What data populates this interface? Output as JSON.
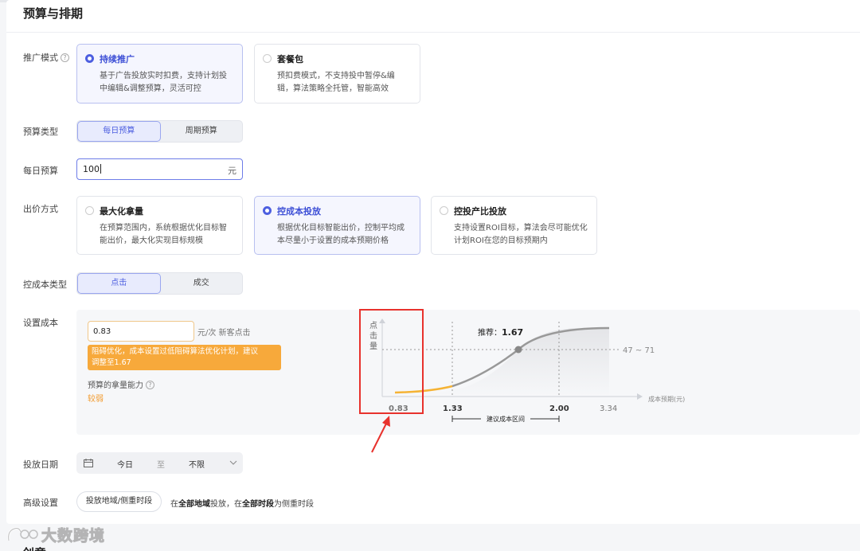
{
  "section": {
    "title": "预算与排期"
  },
  "bottom_title": "创意",
  "promo_mode": {
    "label": "推广模式",
    "options": [
      {
        "title": "持续推广",
        "desc1": "基于广告投放实时扣费，支持计划投",
        "desc2": "中编辑&调整预算，灵活可控",
        "selected": true
      },
      {
        "title": "套餐包",
        "desc1": "预扣费模式，不支持投中暂停&编",
        "desc2": "辑，算法策略全托管，智能高效",
        "selected": false
      }
    ]
  },
  "budget_type": {
    "label": "预算类型",
    "options": [
      "每日预算",
      "周期预算"
    ],
    "selected": "每日预算"
  },
  "daily_budget": {
    "label": "每日预算",
    "value": "100",
    "unit": "元"
  },
  "bid_method": {
    "label": "出价方式",
    "options": [
      {
        "title": "最大化拿量",
        "desc1": "在预算范围内，系统根据优化目标智",
        "desc2": "能出价，最大化实现目标规模",
        "selected": false
      },
      {
        "title": "控成本投放",
        "desc1": "根据优化目标智能出价，控制平均成",
        "desc2": "本尽量小于设置的成本预期价格",
        "selected": true
      },
      {
        "title": "控投产比投放",
        "desc1": "支持设置ROI目标，算法会尽可能优化",
        "desc2": "计划ROI在您的目标预期内",
        "selected": false
      }
    ]
  },
  "cost_type": {
    "label": "控成本类型",
    "options": [
      "点击",
      "成交"
    ],
    "selected": "点击"
  },
  "set_cost": {
    "label": "设置成本",
    "value": "0.83",
    "unit": "元/次 新客点击",
    "warning_line1": "阻碍优化，成本设置过低阻碍算法优化计划，建议",
    "warning_line2": "调整至1.67",
    "capability_label": "预算的拿量能力",
    "capability_value": "较弱"
  },
  "chart_data": {
    "type": "line",
    "ylabel": "点击量",
    "xlabel": "成本预期(元)",
    "x_ticks": [
      "0.83",
      "1.33",
      "2.00",
      "3.34"
    ],
    "recommend_label": "推荐：",
    "recommend_value": "1.67",
    "click_range": "47 ~ 71",
    "suggest_range_label": "建议成本区间",
    "suggest_range": [
      1.33,
      2.0
    ],
    "colors": {
      "low": "#f5b335",
      "curve": "#999999",
      "marker": "#888888"
    }
  },
  "schedule": {
    "label": "投放日期",
    "start": "今日",
    "sep": "至",
    "end": "不限"
  },
  "advanced": {
    "label": "高级设置",
    "button": "投放地域/侧重时段",
    "text_pre": "在",
    "region": "全部地域",
    "text_mid": "投放，在",
    "period": "全部时段",
    "text_post": "为侧重时段"
  },
  "watermark": "大数跨境"
}
